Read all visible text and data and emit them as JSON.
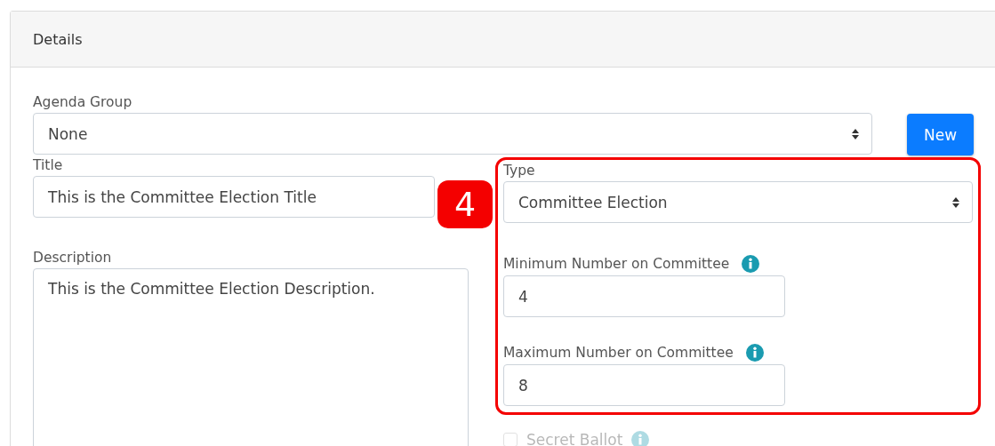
{
  "card": {
    "title": "Details"
  },
  "agenda_group": {
    "label": "Agenda Group",
    "value": "None"
  },
  "new_button": {
    "label": "New"
  },
  "title_field": {
    "label": "Title",
    "value": "This is the Committee Election Title"
  },
  "description": {
    "label": "Description",
    "value": "This is the Committee Election Description."
  },
  "callout": {
    "number": "4"
  },
  "type": {
    "label": "Type",
    "value": "Committee Election"
  },
  "minimum": {
    "label": "Minimum Number on Committee",
    "value": "4"
  },
  "maximum": {
    "label": "Maximum Number on Committee",
    "value": "8"
  },
  "secret_ballot": {
    "label": "Secret Ballot",
    "checked": false,
    "disabled": true
  }
}
